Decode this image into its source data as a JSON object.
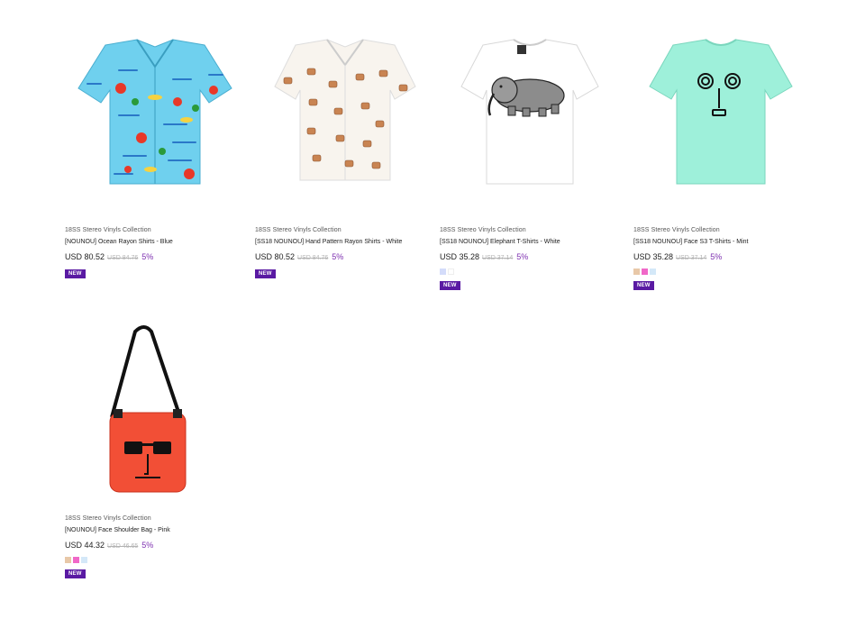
{
  "products": [
    {
      "brand": "18SS Stereo Vinyls Collection",
      "name": "[NOUNOU] Ocean Rayon Shirts - Blue",
      "price": "USD 80.52",
      "original_price": "USD 84.76",
      "discount": "5%",
      "badge": "NEW",
      "swatches": []
    },
    {
      "brand": "18SS Stereo Vinyls Collection",
      "name": "[SS18 NOUNOU] Hand Pattern Rayon Shirts - White",
      "price": "USD 80.52",
      "original_price": "USD 84.76",
      "discount": "5%",
      "badge": "NEW",
      "swatches": []
    },
    {
      "brand": "18SS Stereo Vinyls Collection",
      "name": "[SS18 NOUNOU] Elephant T-Shirts - White",
      "price": "USD 35.28",
      "original_price": "USD 37.14",
      "discount": "5%",
      "badge": "NEW",
      "swatches": [
        "#d4dcfa",
        "#ffffff"
      ]
    },
    {
      "brand": "18SS Stereo Vinyls Collection",
      "name": "[SS18 NOUNOU] Face S3 T-Shirts - Mint",
      "price": "USD 35.28",
      "original_price": "USD 37.14",
      "discount": "5%",
      "badge": "NEW",
      "swatches": [
        "#e8c8a8",
        "#f068c8",
        "#d4e8f8"
      ]
    },
    {
      "brand": "18SS Stereo Vinyls Collection",
      "name": "[NOUNOU] Face Shoulder Bag - Pink",
      "price": "USD 44.32",
      "original_price": "USD 46.65",
      "discount": "5%",
      "badge": "NEW",
      "swatches": [
        "#e8c8a8",
        "#f068c8",
        "#d4e8f8"
      ]
    }
  ],
  "colors": {
    "discount": "#7e30b0",
    "badge_bg": "#5a1aa3",
    "old_price": "#b3b3b3"
  }
}
